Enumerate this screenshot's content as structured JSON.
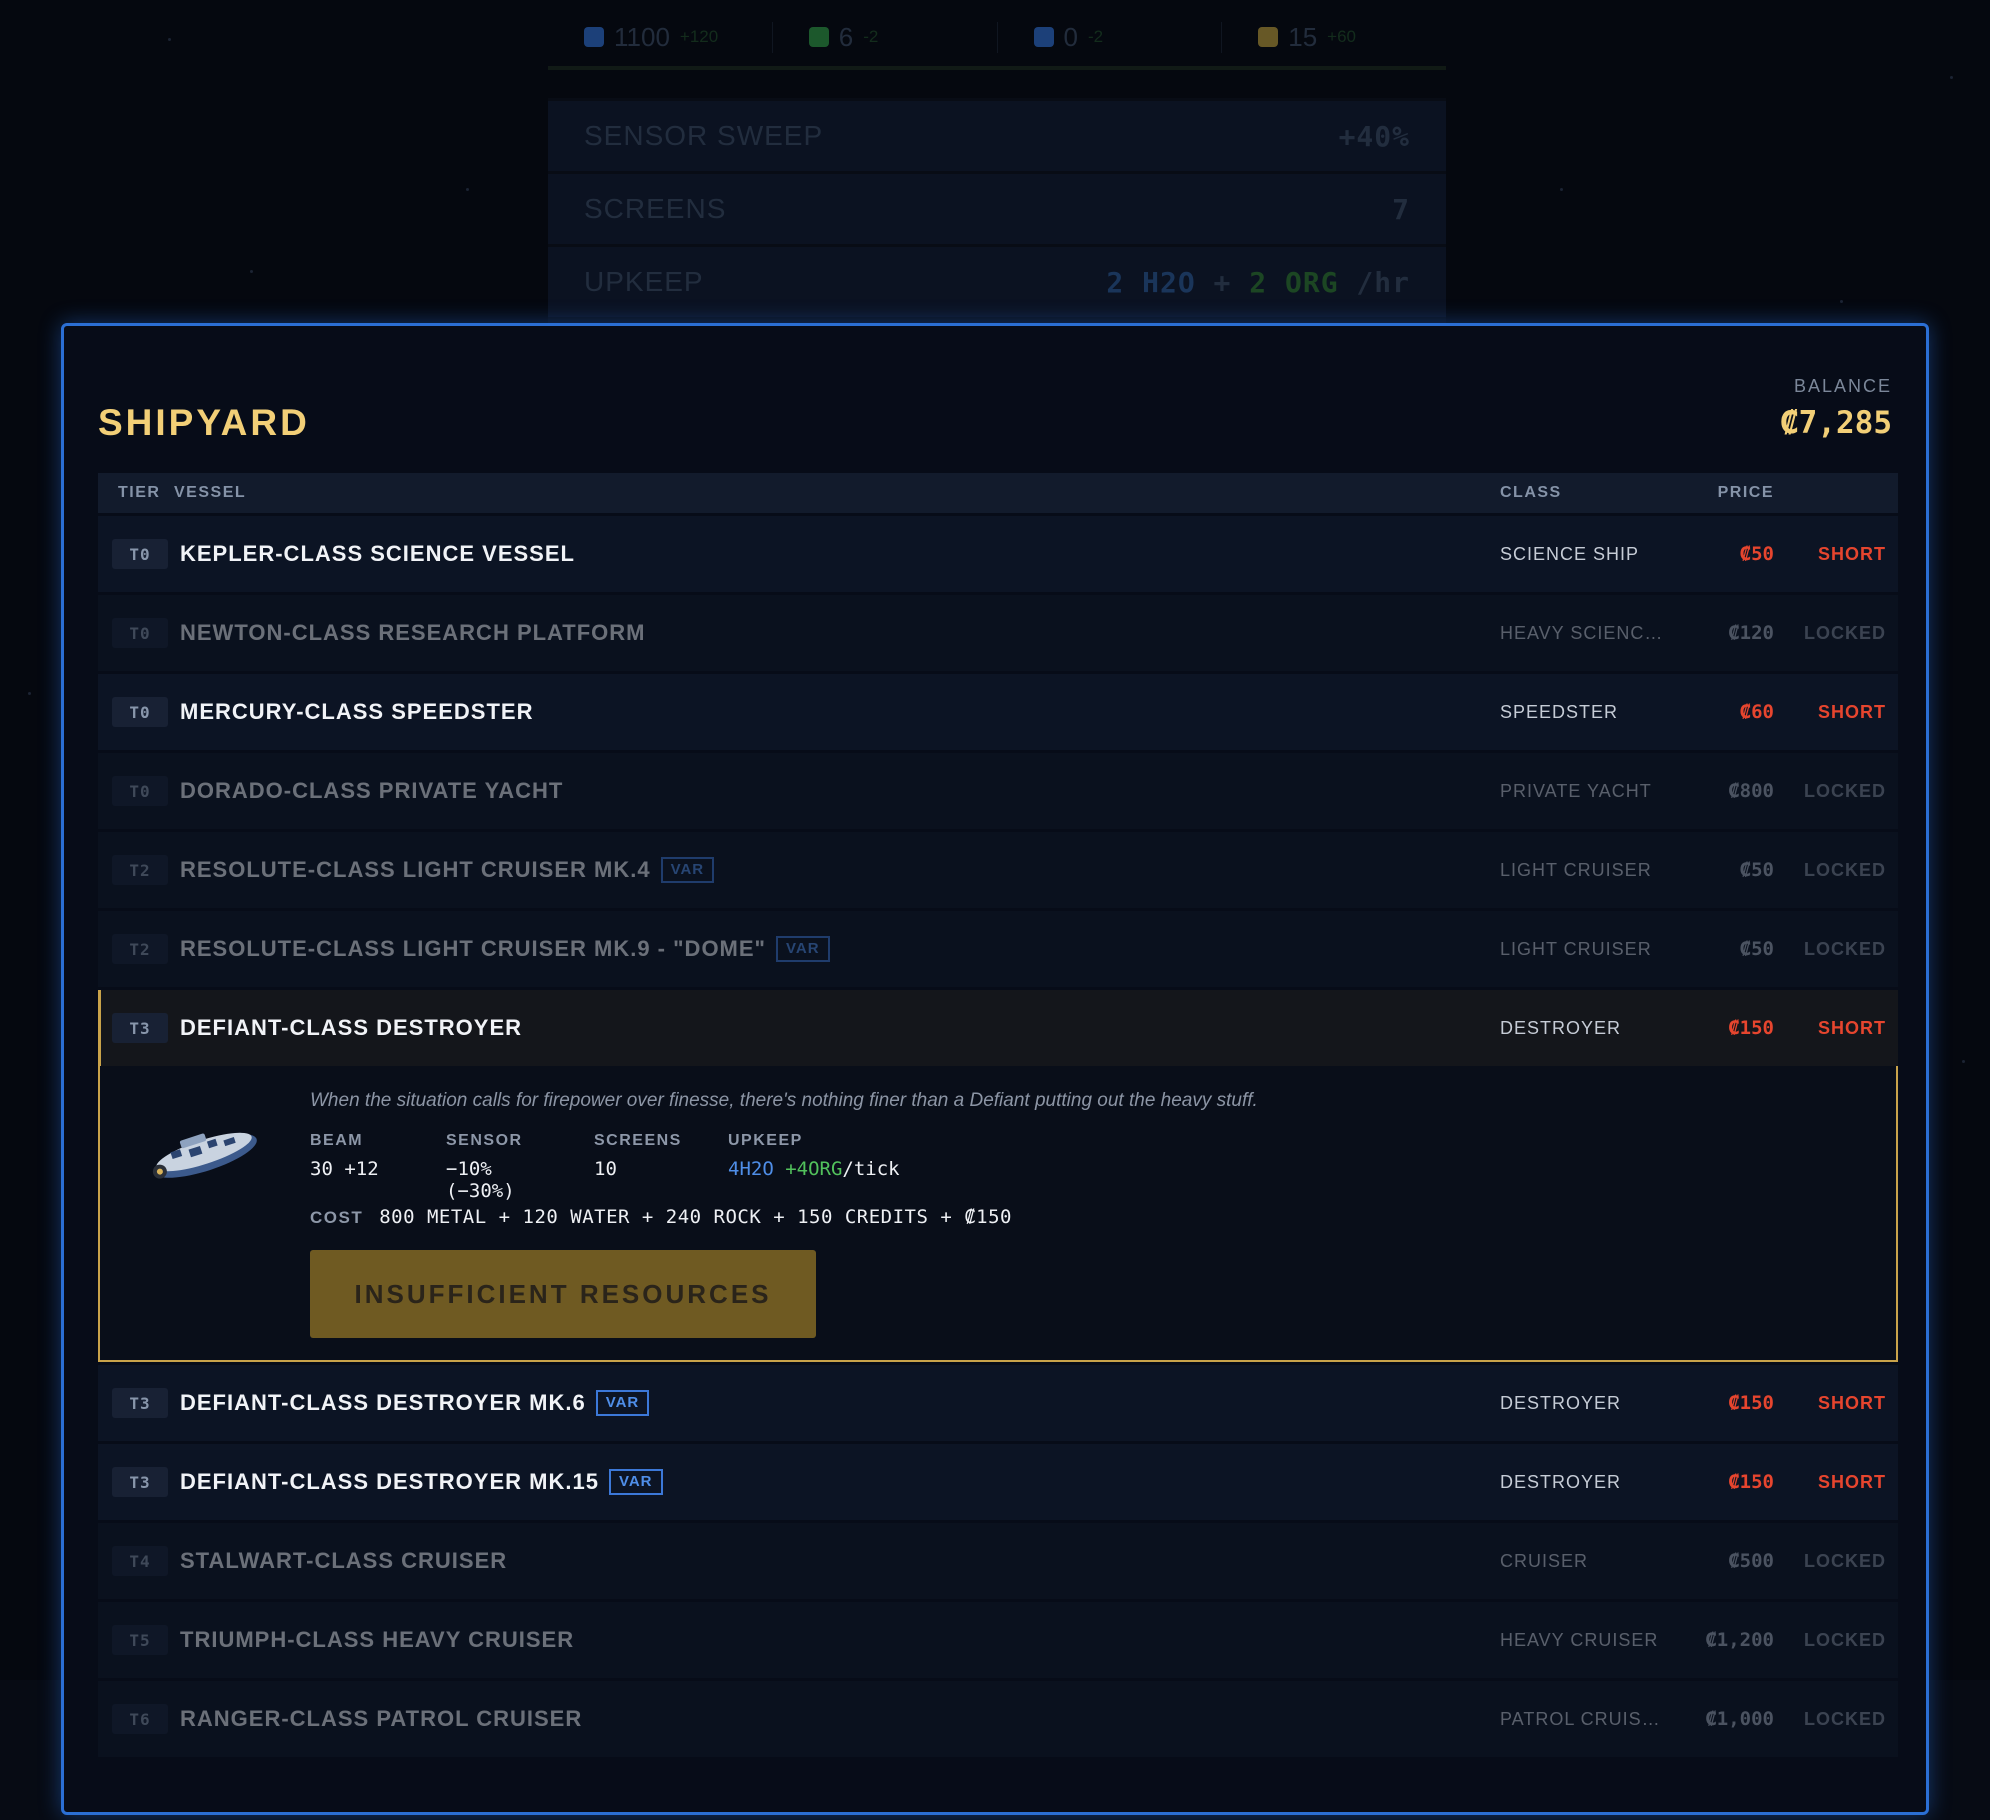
{
  "hud": {
    "resources": [
      {
        "icon": "hex-icon",
        "color": "#2f6fd0",
        "value": "1100",
        "delta": "+120"
      },
      {
        "icon": "leaf-icon",
        "color": "#2f9a45",
        "value": "6",
        "delta": "-2"
      },
      {
        "icon": "water-drop-icon",
        "color": "#2f6fd0",
        "value": "0",
        "delta": "-2"
      },
      {
        "icon": "ore-icon",
        "color": "#b89a3a",
        "value": "15",
        "delta": "+60"
      }
    ],
    "background_stats": [
      {
        "label": "SENSOR SWEEP",
        "value": "+40%"
      },
      {
        "label": "SCREENS",
        "value": "7"
      },
      {
        "label": "UPKEEP",
        "value_water": "2 H2O",
        "value_plus": " + ",
        "value_org": "2 ORG",
        "value_suffix": " /hr"
      }
    ]
  },
  "shipyard": {
    "title": "SHIPYARD",
    "balance_label": "BALANCE",
    "balance_value": "₡7,285",
    "columns": {
      "tier": "TIER",
      "vessel": "VESSEL",
      "class": "CLASS",
      "price": "PRICE"
    },
    "rows_before": [
      {
        "tier": "T0",
        "name": "KEPLER-CLASS SCIENCE VESSEL",
        "var": "",
        "class": "SCIENCE SHIP",
        "price": "₡50",
        "status": "SHORT",
        "locked": false
      },
      {
        "tier": "T0",
        "name": "NEWTON-CLASS RESEARCH PLATFORM",
        "var": "",
        "class": "HEAVY SCIENC…",
        "price": "₡120",
        "status": "LOCKED",
        "locked": true
      },
      {
        "tier": "T0",
        "name": "MERCURY-CLASS SPEEDSTER",
        "var": "",
        "class": "SPEEDSTER",
        "price": "₡60",
        "status": "SHORT",
        "locked": false
      },
      {
        "tier": "T0",
        "name": "DORADO-CLASS PRIVATE YACHT",
        "var": "",
        "class": "PRIVATE YACHT",
        "price": "₡800",
        "status": "LOCKED",
        "locked": true
      },
      {
        "tier": "T2",
        "name": "RESOLUTE-CLASS LIGHT CRUISER MK.4",
        "var": "VAR",
        "class": "LIGHT CRUISER",
        "price": "₡50",
        "status": "LOCKED",
        "locked": true
      },
      {
        "tier": "T2",
        "name": "RESOLUTE-CLASS LIGHT CRUISER MK.9 - \"DOME\"",
        "var": "VAR",
        "class": "LIGHT CRUISER",
        "price": "₡50",
        "status": "LOCKED",
        "locked": true
      }
    ],
    "selected": {
      "tier": "T3",
      "name": "DEFIANT-CLASS DESTROYER",
      "class": "DESTROYER",
      "price": "₡150",
      "status": "SHORT",
      "description": "When the situation calls for firepower over finesse, there's nothing finer than a Defiant putting out the heavy stuff.",
      "stats": {
        "beam_label": "BEAM",
        "beam_value": "30 +12",
        "sensor_label": "SENSOR",
        "sensor_value": "−10% (−30%)",
        "screens_label": "SCREENS",
        "screens_value": "10",
        "upkeep_label": "UPKEEP",
        "upkeep_water": "4H2O",
        "upkeep_org": " +4ORG",
        "upkeep_suffix": "/tick"
      },
      "cost_label": "COST",
      "cost_value": "800 METAL + 120 WATER + 240 ROCK + 150 CREDITS + ₡150",
      "button_label": "INSUFFICIENT RESOURCES"
    },
    "rows_after": [
      {
        "tier": "T3",
        "name": "DEFIANT-CLASS DESTROYER MK.6",
        "var": "VAR",
        "class": "DESTROYER",
        "price": "₡150",
        "status": "SHORT",
        "locked": false
      },
      {
        "tier": "T3",
        "name": "DEFIANT-CLASS DESTROYER MK.15",
        "var": "VAR",
        "class": "DESTROYER",
        "price": "₡150",
        "status": "SHORT",
        "locked": false
      },
      {
        "tier": "T4",
        "name": "STALWART-CLASS CRUISER",
        "var": "",
        "class": "CRUISER",
        "price": "₡500",
        "status": "LOCKED",
        "locked": true
      },
      {
        "tier": "T5",
        "name": "TRIUMPH-CLASS HEAVY CRUISER",
        "var": "",
        "class": "HEAVY CRUISER",
        "price": "₡1,200",
        "status": "LOCKED",
        "locked": true
      },
      {
        "tier": "T6",
        "name": "RANGER-CLASS PATROL CRUISER",
        "var": "",
        "class": "PATROL CRUIS…",
        "price": "₡1,000",
        "status": "LOCKED",
        "locked": true
      }
    ]
  }
}
